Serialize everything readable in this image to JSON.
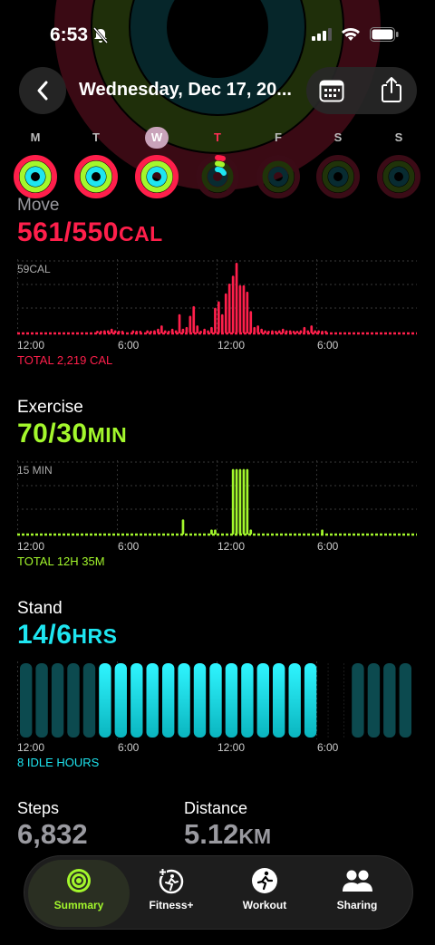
{
  "status": {
    "time": "6:53"
  },
  "header": {
    "date": "Wednesday, Dec 17, 20..."
  },
  "week": [
    {
      "letter": "M",
      "state": "done"
    },
    {
      "letter": "T",
      "state": "done"
    },
    {
      "letter": "W",
      "state": "selected"
    },
    {
      "letter": "T",
      "state": "today"
    },
    {
      "letter": "F",
      "state": "empty"
    },
    {
      "letter": "S",
      "state": "empty"
    },
    {
      "letter": "S",
      "state": "empty"
    }
  ],
  "move": {
    "title": "Move",
    "value": "561/550",
    "unit": "CAL",
    "max_label": "59CAL",
    "total": "TOTAL 2,219 CAL",
    "color": "#ff1f4b",
    "x_labels": [
      "12:00",
      "6:00",
      "12:00",
      "6:00"
    ],
    "bars": [
      0,
      0,
      0,
      0,
      0,
      0,
      0,
      0,
      0,
      0,
      0,
      0,
      0,
      0,
      0,
      0,
      0,
      0,
      0,
      0,
      0,
      0,
      1,
      1,
      2,
      2,
      3,
      2,
      1,
      1,
      0,
      0,
      2,
      1,
      1,
      0,
      2,
      1,
      2,
      3,
      5,
      2,
      1,
      3,
      2,
      12,
      3,
      4,
      11,
      17,
      5,
      1,
      3,
      2,
      4,
      16,
      20,
      12,
      25,
      31,
      36,
      44,
      30,
      30,
      26,
      14,
      4,
      5,
      3,
      2,
      1,
      2,
      1,
      2,
      3,
      2,
      2,
      1,
      1,
      2,
      4,
      2,
      5,
      2,
      2,
      1,
      1,
      0,
      0,
      0,
      0,
      0,
      0,
      0,
      0,
      0,
      0,
      0,
      0,
      0,
      0,
      0,
      0,
      0,
      0,
      0,
      0,
      0,
      0,
      0,
      0,
      0
    ]
  },
  "exercise": {
    "title": "Exercise",
    "value": "70/30",
    "unit": "MIN",
    "max_label": "15 MIN",
    "total": "TOTAL 12H 35M",
    "color": "#a3f72c",
    "x_labels": [
      "12:00",
      "6:00",
      "12:00",
      "6:00"
    ],
    "bars": [
      0,
      0,
      0,
      0,
      0,
      0,
      0,
      0,
      0,
      0,
      0,
      0,
      0,
      0,
      0,
      0,
      0,
      0,
      0,
      0,
      0,
      0,
      0,
      0,
      0,
      0,
      0,
      0,
      0,
      0,
      0,
      0,
      0,
      0,
      0,
      0,
      0,
      0,
      0,
      0,
      0,
      0,
      0,
      0,
      0,
      0,
      3,
      0,
      0,
      0,
      0,
      0,
      0,
      0,
      1,
      1,
      0,
      0,
      0,
      0,
      13,
      13,
      13,
      13,
      13,
      1,
      0,
      0,
      0,
      0,
      0,
      0,
      0,
      0,
      0,
      0,
      0,
      0,
      0,
      0,
      0,
      0,
      0,
      0,
      0,
      1,
      0,
      0,
      0,
      0,
      0,
      0,
      0,
      0,
      0,
      0,
      0,
      0,
      0,
      0,
      0,
      0,
      0,
      0,
      0,
      0,
      0,
      0,
      0,
      0,
      0,
      0
    ]
  },
  "stand": {
    "title": "Stand",
    "value": "14/6",
    "unit": "HRS",
    "idle": "8 IDLE HOURS",
    "color": "#1ee5f0",
    "x_labels": [
      "12:00",
      "6:00",
      "12:00",
      "6:00"
    ],
    "hours": [
      0,
      0,
      0,
      0,
      0,
      1,
      1,
      1,
      1,
      1,
      1,
      1,
      1,
      1,
      1,
      1,
      1,
      1,
      1,
      -1,
      -1,
      0,
      0,
      0,
      0
    ]
  },
  "stats": {
    "steps_title": "Steps",
    "steps_value": "6,832",
    "distance_title": "Distance",
    "distance_value": "5.12",
    "distance_unit": "KM"
  },
  "tabs": [
    {
      "label": "Summary",
      "icon": "rings-icon",
      "active": true
    },
    {
      "label": "Fitness+",
      "icon": "fitness-plus-icon",
      "active": false
    },
    {
      "label": "Workout",
      "icon": "workout-icon",
      "active": false
    },
    {
      "label": "Sharing",
      "icon": "sharing-icon",
      "active": false
    }
  ]
}
